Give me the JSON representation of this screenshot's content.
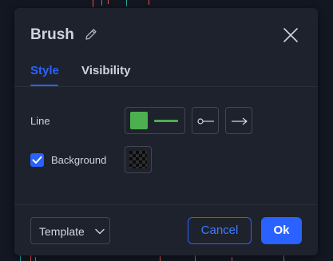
{
  "dialog": {
    "title": "Brush",
    "edit_icon": "pencil-icon",
    "close_icon": "close-icon"
  },
  "tabs": [
    {
      "label": "Style",
      "active": true
    },
    {
      "label": "Visibility",
      "active": false
    }
  ],
  "style": {
    "line": {
      "label": "Line",
      "color": "#4caf50",
      "line_start_icon": "line-start-circle-icon",
      "line_end_icon": "line-end-arrow-icon"
    },
    "background": {
      "label": "Background",
      "checked": true,
      "color": "transparent"
    }
  },
  "footer": {
    "template_label": "Template",
    "template_icon": "chevron-down-icon",
    "cancel_label": "Cancel",
    "ok_label": "Ok"
  },
  "colors": {
    "accent": "#2962ff",
    "dialog_bg": "#1e222d",
    "page_bg": "#131722",
    "text": "#d1d4dc",
    "border": "#434651",
    "bull": "#26a69a",
    "bear": "#ef5350"
  }
}
